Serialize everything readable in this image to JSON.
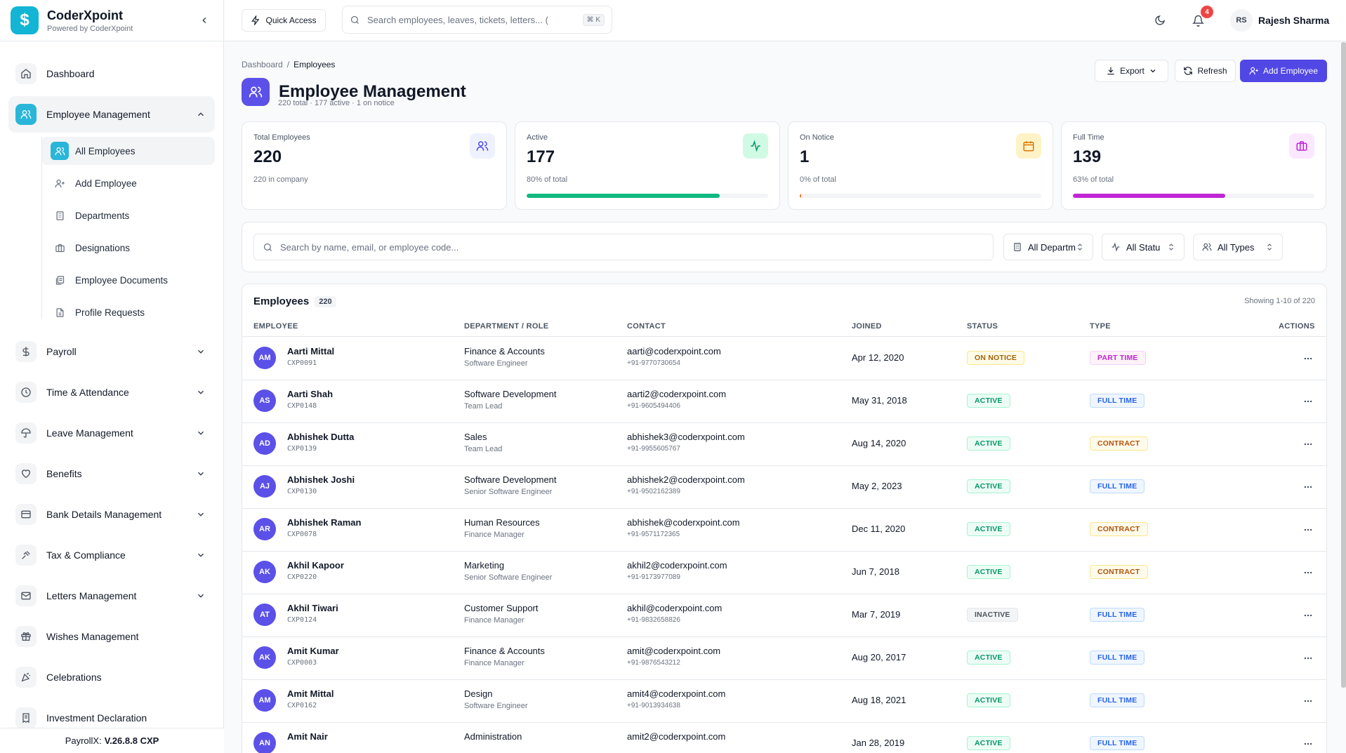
{
  "brand": {
    "name": "CoderXpoint",
    "sub": "Powered by CoderXpoint",
    "logo_glyph": "$",
    "color": "#12b5d4"
  },
  "sidebar": {
    "items": [
      {
        "label": "Dashboard",
        "icon": "home-icon"
      },
      {
        "label": "Employee Management",
        "icon": "users-icon",
        "active": true
      },
      {
        "label": "Payroll",
        "icon": "dollar-icon"
      },
      {
        "label": "Time & Attendance",
        "icon": "clock-icon"
      },
      {
        "label": "Leave Management",
        "icon": "umbrella-icon"
      },
      {
        "label": "Benefits",
        "icon": "heart-icon"
      },
      {
        "label": "Bank Details Management",
        "icon": "card-icon"
      },
      {
        "label": "Tax & Compliance",
        "icon": "gavel-icon"
      },
      {
        "label": "Letters Management",
        "icon": "mail-icon"
      },
      {
        "label": "Wishes Management",
        "icon": "gift-icon"
      },
      {
        "label": "Celebrations",
        "icon": "party-icon"
      },
      {
        "label": "Investment Declaration",
        "icon": "receipt-icon"
      }
    ],
    "sub_items": [
      {
        "label": "All Employees",
        "icon": "users-icon",
        "active": true
      },
      {
        "label": "Add Employee",
        "icon": "user-plus-icon"
      },
      {
        "label": "Departments",
        "icon": "building-icon"
      },
      {
        "label": "Designations",
        "icon": "briefcase-icon"
      },
      {
        "label": "Employee Documents",
        "icon": "documents-icon"
      },
      {
        "label": "Profile Requests",
        "icon": "file-icon"
      }
    ],
    "footer_prefix": "PayrollX:",
    "footer_version": "V.26.8.8 CXP"
  },
  "topbar": {
    "quick_access": "Quick Access",
    "search_placeholder": "Search employees, leaves, tickets, letters... (",
    "search_kbd": "⌘ K",
    "notification_count": "4",
    "user_initials": "RS",
    "user_name": "Rajesh Sharma"
  },
  "page": {
    "breadcrumb_root": "Dashboard",
    "breadcrumb_sep": "/",
    "breadcrumb_current": "Employees",
    "title": "Employee Management",
    "subtitle": "220 total · 177 active · 1 on notice",
    "export_label": "Export",
    "refresh_label": "Refresh",
    "add_label": "Add Employee",
    "accent": "#5147e5"
  },
  "stats": [
    {
      "label": "Total Employees",
      "value": "220",
      "foot": "220 in company",
      "icon": "users-icon",
      "icon_bg": "#eef2ff",
      "icon_color": "#4f46e5"
    },
    {
      "label": "Active",
      "value": "177",
      "foot": "80% of total",
      "icon": "activity-icon",
      "icon_bg": "#d1fae5",
      "icon_color": "#059669",
      "progress": 0.8,
      "bar_color": "#10b981"
    },
    {
      "label": "On Notice",
      "value": "1",
      "foot": "0% of total",
      "icon": "calendar-icon",
      "icon_bg": "#fef3c7",
      "icon_color": "#d97706",
      "progress": 0.005,
      "bar_color": "#f97316"
    },
    {
      "label": "Full Time",
      "value": "139",
      "foot": "63% of total",
      "icon": "briefcase-icon",
      "icon_bg": "#fae8ff",
      "icon_color": "#c026d3",
      "progress": 0.63,
      "bar_color": "#c026d3"
    }
  ],
  "filters": {
    "search_placeholder": "Search by name, email, or employee code...",
    "department": "All Departm",
    "status": "All Statu",
    "type": "All Types"
  },
  "table": {
    "title": "Employees",
    "count": "220",
    "showing": "Showing 1-10 of 220",
    "columns": [
      "EMPLOYEE",
      "DEPARTMENT / ROLE",
      "CONTACT",
      "JOINED",
      "STATUS",
      "TYPE",
      "ACTIONS"
    ],
    "rows": [
      {
        "initials": "AM",
        "name": "Aarti Mittal",
        "code": "CXP0091",
        "dept": "Finance & Accounts",
        "role": "Software Engineer",
        "email": "aarti@coderxpoint.com",
        "phone": "+91-9770730654",
        "joined": "Apr 12, 2020",
        "status": "ON NOTICE",
        "type": "PART TIME"
      },
      {
        "initials": "AS",
        "name": "Aarti Shah",
        "code": "CXP0148",
        "dept": "Software Development",
        "role": "Team Lead",
        "email": "aarti2@coderxpoint.com",
        "phone": "+91-9605494406",
        "joined": "May 31, 2018",
        "status": "ACTIVE",
        "type": "FULL TIME"
      },
      {
        "initials": "AD",
        "name": "Abhishek Dutta",
        "code": "CXP0139",
        "dept": "Sales",
        "role": "Team Lead",
        "email": "abhishek3@coderxpoint.com",
        "phone": "+91-9955605767",
        "joined": "Aug 14, 2020",
        "status": "ACTIVE",
        "type": "CONTRACT"
      },
      {
        "initials": "AJ",
        "name": "Abhishek Joshi",
        "code": "CXP0130",
        "dept": "Software Development",
        "role": "Senior Software Engineer",
        "email": "abhishek2@coderxpoint.com",
        "phone": "+91-9502162389",
        "joined": "May 2, 2023",
        "status": "ACTIVE",
        "type": "FULL TIME"
      },
      {
        "initials": "AR",
        "name": "Abhishek Raman",
        "code": "CXP0078",
        "dept": "Human Resources",
        "role": "Finance Manager",
        "email": "abhishek@coderxpoint.com",
        "phone": "+91-9571172365",
        "joined": "Dec 11, 2020",
        "status": "ACTIVE",
        "type": "CONTRACT"
      },
      {
        "initials": "AK",
        "name": "Akhil Kapoor",
        "code": "CXP0220",
        "dept": "Marketing",
        "role": "Senior Software Engineer",
        "email": "akhil2@coderxpoint.com",
        "phone": "+91-9173977089",
        "joined": "Jun 7, 2018",
        "status": "ACTIVE",
        "type": "CONTRACT"
      },
      {
        "initials": "AT",
        "name": "Akhil Tiwari",
        "code": "CXP0124",
        "dept": "Customer Support",
        "role": "Finance Manager",
        "email": "akhil@coderxpoint.com",
        "phone": "+91-9832658826",
        "joined": "Mar 7, 2019",
        "status": "INACTIVE",
        "type": "FULL TIME"
      },
      {
        "initials": "AK",
        "name": "Amit Kumar",
        "code": "CXP0003",
        "dept": "Finance & Accounts",
        "role": "Finance Manager",
        "email": "amit@coderxpoint.com",
        "phone": "+91-9876543212",
        "joined": "Aug 20, 2017",
        "status": "ACTIVE",
        "type": "FULL TIME"
      },
      {
        "initials": "AM",
        "name": "Amit Mittal",
        "code": "CXP0162",
        "dept": "Design",
        "role": "Software Engineer",
        "email": "amit4@coderxpoint.com",
        "phone": "+91-9013934638",
        "joined": "Aug 18, 2021",
        "status": "ACTIVE",
        "type": "FULL TIME"
      },
      {
        "initials": "AN",
        "name": "Amit Nair",
        "code": "",
        "dept": "Administration",
        "role": "",
        "email": "amit2@coderxpoint.com",
        "phone": "",
        "joined": "Jan 28, 2019",
        "status": "ACTIVE",
        "type": "FULL TIME"
      }
    ]
  }
}
